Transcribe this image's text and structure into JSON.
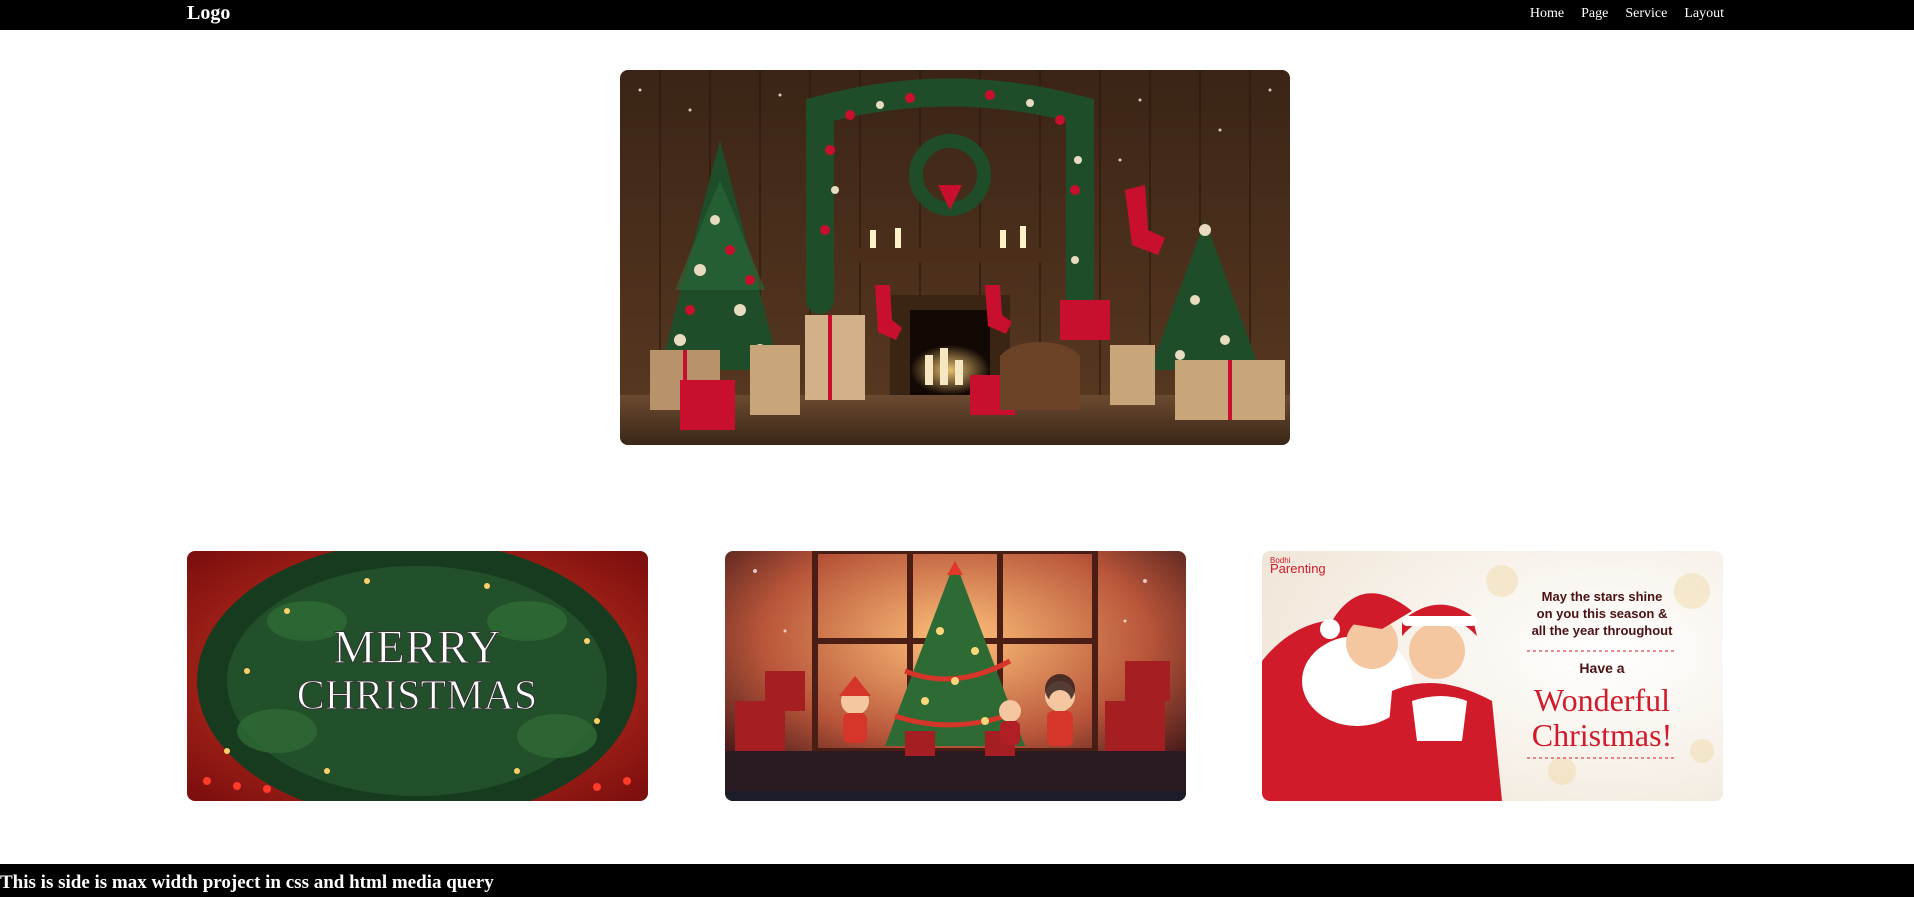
{
  "navbar": {
    "logo": "Logo",
    "links": [
      "Home",
      "Page",
      "Service",
      "Layout"
    ]
  },
  "hero": {
    "image": "christmas-fireplace-scene"
  },
  "cards": [
    {
      "image": "merry-christmas-wreath",
      "text_line1": "MERRY",
      "text_line2": "CHRISTMAS"
    },
    {
      "image": "kids-christmas-tree-scene"
    },
    {
      "image": "santa-hug-greeting",
      "brand_small": "Bodhi",
      "brand": "Parenting",
      "message_1": "May the stars shine",
      "message_2": "on you this season &",
      "message_3": "all the year throughout",
      "message_4": "Have a",
      "headline_1": "Wonderful",
      "headline_2": "Christmas!"
    }
  ],
  "footer": {
    "text": "This is side is max width project in css and html media query"
  },
  "colors": {
    "navbar_bg": "#000000",
    "footer_bg": "#000000",
    "christmas_red": "#c8102e",
    "tree_green": "#1f4d2a"
  }
}
